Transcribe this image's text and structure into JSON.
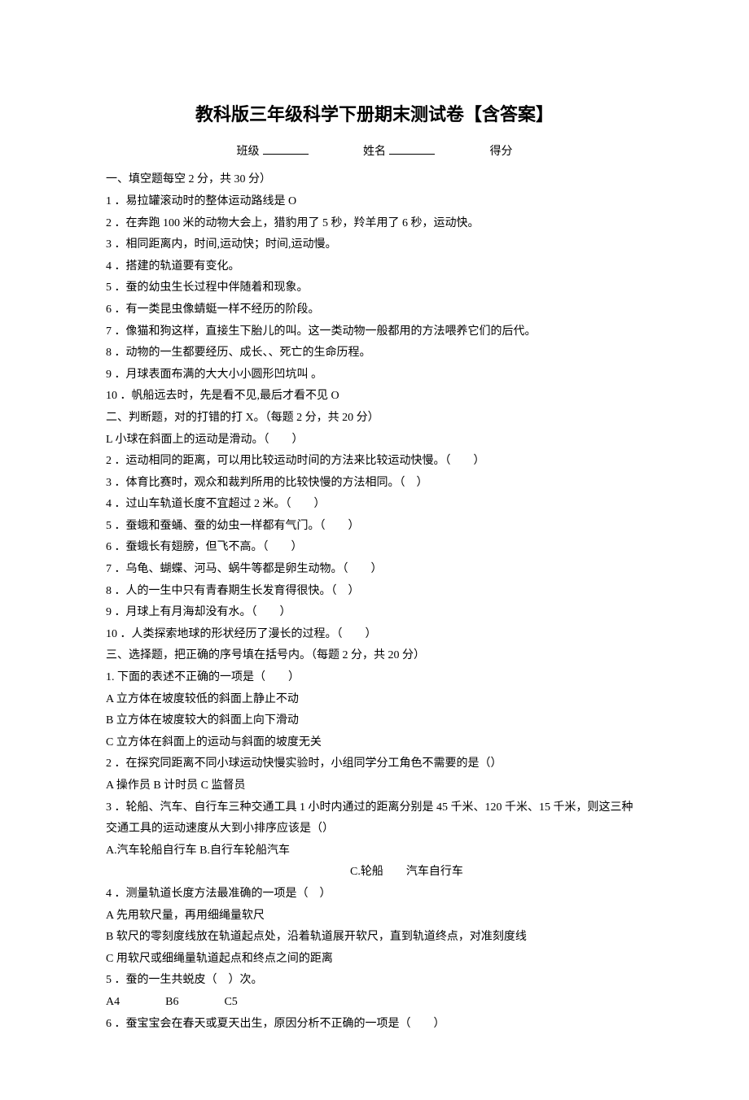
{
  "title": "教科版三年级科学下册期末测试卷【含答案】",
  "header": {
    "class_label": "班级",
    "name_label": "姓名",
    "score_label": "得分"
  },
  "s1": {
    "head": "一、填空题每空 2 分，共 30 分）",
    "q1": "1 ．易拉罐滚动时的整体运动路线是 O",
    "q2": "2 ．在奔跑 100 米的动物大会上，猎豹用了 5 秒，羚羊用了 6 秒，运动快。",
    "q3": "3 ．相同距离内，时间,运动快；时间,运动慢。",
    "q4": "4 ．搭建的轨道要有变化。",
    "q5": "5 ．蚕的幼虫生长过程中伴随着和现象。",
    "q6": "6 ．有一类昆虫像蜻蜓一样不经历的阶段。",
    "q7": "7 ．像猫和狗这样，直接生下胎儿的叫。这一类动物一般都用的方法喂养它们的后代。",
    "q8": "8 ．动物的一生都要经历、成长、、死亡的生命历程。",
    "q9": "9 ．月球表面布满的大大小小圆形凹坑叫 。",
    "q10": "10 ．帆船远去时，先是看不见,最后才看不见 O"
  },
  "s2": {
    "head": "二、判断题，对的打错的打 X。（每题 2 分，共 20 分）",
    "q1": "L 小球在斜面上的运动是滑动。（　　）",
    "q2": "2 ．运动相同的距离，可以用比较运动时间的方法来比较运动快慢。（　　）",
    "q3": "3 ．体育比赛时，观众和裁判所用的比较快慢的方法相同。（　）",
    "q4": "4 ．过山车轨道长度不宜超过 2 米。（　　）",
    "q5": "5 ．蚕蛾和蚕蛹、蚕的幼虫一样都有气门。（　　）",
    "q6": "6 ．蚕蛾长有翅膀，但飞不高。（　　）",
    "q7": "7 ．乌龟、蝴蝶、河马、蜗牛等都是卵生动物。（　　）",
    "q8": "8 ．人的一生中只有青春期生长发育得很快。（　）",
    "q9": "9 ．月球上有月海却没有水。（　　）",
    "q10": "10 ．人类探索地球的形状经历了漫长的过程。（　　）"
  },
  "s3": {
    "head": "三、选择题，把正确的序号填在括号内。（每题 2 分，共 20 分）",
    "q1": "1. 下面的表述不正确的一项是（　　）",
    "q1a": "A 立方体在坡度较低的斜面上静止不动",
    "q1b": "B 立方体在坡度较大的斜面上向下滑动",
    "q1c": "C 立方体在斜面上的运动与斜面的坡度无关",
    "q2": "2 ．在探究同距离不同小球运动快慢实验时，小组同学分工角色不需要的是（）",
    "q2a": "A 操作员 B 计时员 C 监督员",
    "q3": "3 ．轮船、汽车、自行车三种交通工具 1 小时内通过的距离分别是 45 千米、120 千米、15 千米，则这三种交通工具的运动速度从大到小排序应该是（）",
    "q3a": "A.汽车轮船自行车 B.自行车轮船汽车",
    "q3c": "C.轮船　　汽车自行车",
    "q4": "4 ．测量轨道长度方法最准确的一项是（　）",
    "q4a": "A 先用软尺量，再用细绳量软尺",
    "q4b": "B 软尺的零刻度线放在轨道起点处，沿着轨道展开软尺，直到轨道终点，对准刻度线",
    "q4c": "C 用软尺或细绳量轨道起点和终点之间的距离",
    "q5": "5 ．蚕的一生共蜕皮（　）次。",
    "q5a": "A4　　　　B6　　　　C5",
    "q6": "6 ．蚕宝宝会在春天或夏天出生，原因分析不正确的一项是（　　）"
  }
}
